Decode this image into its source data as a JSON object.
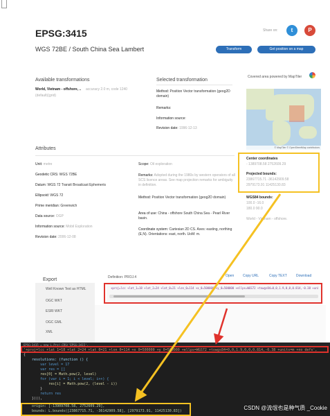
{
  "header": {
    "title": "EPSG:3415",
    "subtitle": "WGS 72BE / South China Sea Lambert",
    "share_label": "Share on:",
    "share_twitter_glyph": "t",
    "share_pinterest_glyph": "P",
    "transform_button": "Transform",
    "get_position_button": "Get position on a map"
  },
  "available_transformations": {
    "heading": "Available transformations",
    "item_name": "World, Vietnam - offshore, ..",
    "item_accuracy": "accuracy 2.0 m, code 1240",
    "item_default": "(default)(grid)"
  },
  "selected_transformation": {
    "heading": "Selected transformation",
    "method_label": "Method:",
    "method_value": "Position Vector transformation (geog2D domain)",
    "remarks_label": "Remarks:",
    "info_source_label": "Information source:",
    "revision_label": "Revision date:",
    "revision_value": "1996-12-13"
  },
  "map": {
    "covered_label": "Covered area powered by MapTiler",
    "attribution": "© MapTiler © OpenStreetMap contributors",
    "logo_icon": "maptiler-logo-icon"
  },
  "coordinates": {
    "center_label": "Center coordinates",
    "center_value": "- 1389708.58 2752609.29",
    "projected_label": "Projected bounds:",
    "projected_line1": "23867715.71 -36142909.58",
    "projected_line2": "2979173.91 11425130.83",
    "wgs84_label": "WGS84 bounds:",
    "wgs84_line1": "100.0 -16.0",
    "wgs84_line2": "180.0 90.0",
    "scope_area": "World - Vietnam - offshore."
  },
  "attributes": {
    "heading": "Attributes",
    "left": [
      {
        "label": "Unit:",
        "value": "metre"
      },
      {
        "label": "Geodetic CRS:",
        "value": "WGS 72BE"
      },
      {
        "label": "Datum:",
        "value": "WGS 72 Transit Broadcast Ephemeris"
      },
      {
        "label": "Ellipsoid:",
        "value": "WGS 72"
      },
      {
        "label": "Prime meridian:",
        "value": "Greenwich"
      },
      {
        "label": "Data source:",
        "value": "OGP"
      },
      {
        "label": "Information source:",
        "value": "Mobil Exploration"
      },
      {
        "label": "Revision date:",
        "value": "2006-12-08"
      }
    ],
    "scope_label": "Scope:",
    "scope_value": "Oil exploration",
    "remarks_label": "Remarks:",
    "remarks_value": "Adopted during the 1980s by western operators of all SCS licence areas. See map projection remarks for ambiguity in definition.",
    "method_label": "Method:",
    "method_value": "Position Vector transformation (geog2D domain)",
    "area_label": "Area of use:",
    "area_value": "China - offshore South China Sea - Pearl River basin.",
    "cs_label": "Coordinate system:",
    "cs_value": "Cartesian 2D CS. Axes: easting, northing (E,N). Orientations: east, north. UoM: m."
  },
  "export": {
    "title": "Export",
    "definition_label": "Definition: PROJ.4",
    "actions": [
      "Open",
      "Copy URL",
      "Copy TEXT",
      "Download"
    ],
    "formats": [
      "Well Known Text as HTML",
      "OGC WKT",
      "ESRI WKT",
      "OGC GML",
      "XML"
    ],
    "proj4_string": "+proj=lcc +lat_1=18 +lat_2=24 +lat_0=21 +lon_0=114 +x_0=500000 +y_0=500000 +ellps=WGS72 +towgs84=0,0,1.9,0,0,0.814,-0.38 +units=m +no_defs"
  },
  "editor": {
    "tab_text": "EPSG:3415 = new L.Proj.CRS('EPSG:3415',",
    "line0": "'+proj=lcc +lat_1=18 +lat_2=24 +lat_0=21 +lon_0=114 +x_0=500000 +y_0=500000 +ellps=WGS72 +towgs84=0,0,1.9,0,0,0.814,-0.38 +units=m +no_defs',",
    "line1": "{",
    "line2": "    resolutions: (function () {",
    "line3": "        var level = 17",
    "line4": "        var res = []",
    "line5": "        res[0] = Math.pow(2, level)",
    "line6": "        for (var i = 1; i < level; i++) {",
    "line7": "            res[i] = Math.pow(2, (level - i))",
    "line8": "        }",
    "line9": "        return res",
    "line10": "    })(),",
    "line11": "    origin: [-13909708.58, 2752609.29],",
    "line12": "    bounds: L.bounds([23867715.71, -36142909.58], [2979173.91, 11425130.83])"
  },
  "watermark": "CSDN @流氓也是种气质 _Cookie",
  "colors": {
    "accent": "#2d6fb8",
    "highlight_yellow": "#f5c122",
    "highlight_red": "#e0322c"
  }
}
